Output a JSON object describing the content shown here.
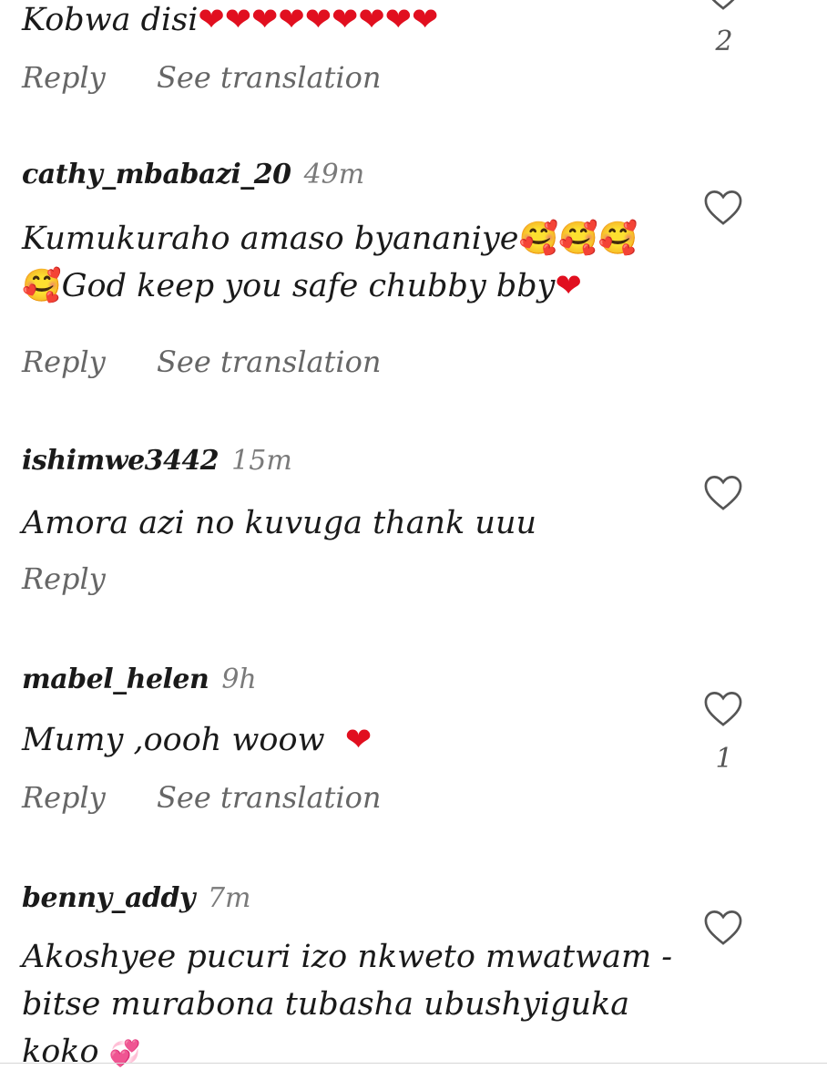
{
  "comments": [
    {
      "user": "",
      "time": "",
      "text": "Kobwa disi",
      "emoji": "❤❤❤❤❤❤❤❤❤",
      "reply": "Reply",
      "translate": "See translation",
      "likes": "2"
    },
    {
      "user": "cathy_mbabazi_20",
      "time": "49m",
      "text": "Kumukuraho amaso byananiye",
      "emoji": "🥰🥰🥰",
      "text2_emoji": "🥰",
      "text2": "God keep you safe chubby bby",
      "text2_end": "❤",
      "reply": "Reply",
      "translate": "See translation",
      "likes": ""
    },
    {
      "user": "ishimwe3442",
      "time": "15m",
      "text": "Amora azi no kuvuga thank uuu",
      "reply": "Reply",
      "likes": ""
    },
    {
      "user": "mabel_helen",
      "time": "9h",
      "text": "Mumy ,oooh woow",
      "emoji": "❤",
      "reply": "Reply",
      "translate": "See translation",
      "likes": "1"
    },
    {
      "user": "benny_addy",
      "time": "7m",
      "text": "Akoshyee pucuri izo nkweto mwatwam - bitse murabona tubasha ubushyiguka koko",
      "emoji": "💞",
      "likes": ""
    }
  ],
  "icons": {
    "like": "heart-outline-icon"
  },
  "colors": {
    "accent_heart": "#e10f1f",
    "muted": "#7a7a7a"
  }
}
